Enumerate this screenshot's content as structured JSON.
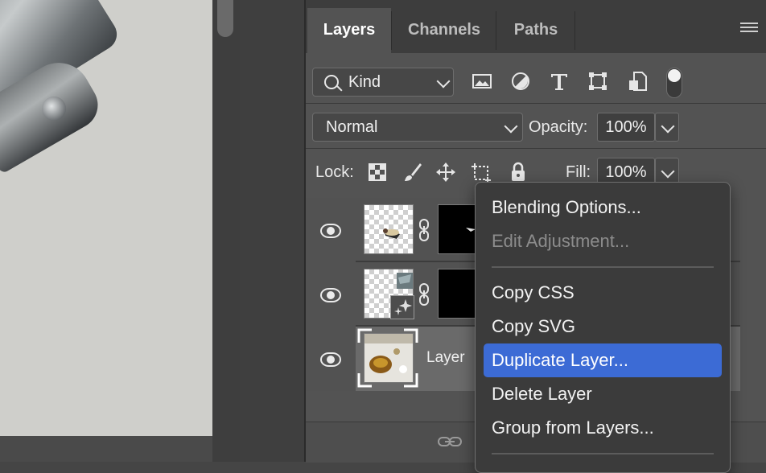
{
  "tabs": [
    "Layers",
    "Channels",
    "Paths"
  ],
  "filter": {
    "kind_label": "Kind",
    "icons": [
      "image-filter-icon",
      "adjustment-filter-icon",
      "type-filter-icon",
      "shape-filter-icon",
      "smart-object-filter-icon"
    ]
  },
  "blend": {
    "mode": "Normal",
    "opacity_label": "Opacity:",
    "opacity_value": "100%"
  },
  "lock": {
    "label": "Lock:",
    "fill_label": "Fill:",
    "fill_value": "100%"
  },
  "layers": [
    {
      "name": ""
    },
    {
      "name": ""
    },
    {
      "name": "Layer"
    }
  ],
  "context_menu": {
    "items": [
      {
        "label": "Blending Options...",
        "state": "normal"
      },
      {
        "label": "Edit Adjustment...",
        "state": "disabled"
      },
      {
        "label": "Copy CSS",
        "state": "normal"
      },
      {
        "label": "Copy SVG",
        "state": "normal"
      },
      {
        "label": "Duplicate Layer...",
        "state": "highlighted"
      },
      {
        "label": "Delete Layer",
        "state": "normal"
      },
      {
        "label": "Group from Layers...",
        "state": "normal"
      }
    ]
  },
  "colors": {
    "menu_highlight": "#3c6bd5",
    "panel_bg": "#535353",
    "menu_bg": "#3b3b3b"
  }
}
